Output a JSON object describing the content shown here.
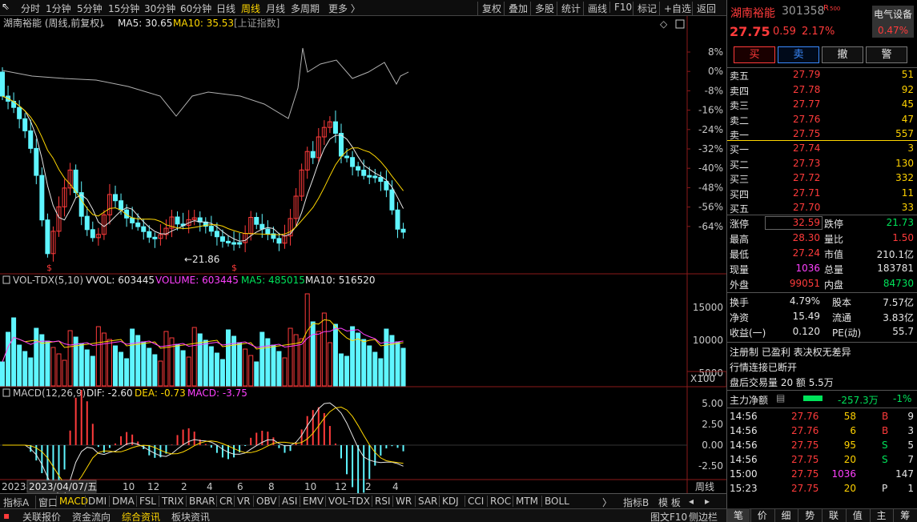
{
  "toolbar": {
    "periods": [
      "分时",
      "1分钟",
      "5分钟",
      "15分钟",
      "30分钟",
      "60分钟",
      "日线",
      "周线",
      "月线",
      "多周期",
      "更多 〉"
    ],
    "active_period": "周线",
    "tools": [
      "复权",
      "叠加",
      "多股",
      "统计",
      "画线",
      "F10",
      "标记",
      "+自选",
      "返回"
    ]
  },
  "main_chart": {
    "title": "湖南裕能 (周线,前复权)",
    "ma5_label": "MA5: 30.65",
    "ma10_label": "MA10: 35.53",
    "overlay_label": "[上证指数]",
    "y_ticks": [
      "8%",
      "0%",
      "-8%",
      "-16%",
      "-24%",
      "-32%",
      "-40%",
      "-48%",
      "-56%",
      "-64%"
    ],
    "low_marker": "21.86"
  },
  "volume_panel": {
    "name": "VOL-TDX(5,10)",
    "vvol": "VVOL: 603445",
    "volume": "VOLUME: 603445",
    "ma5": "MA5: 485015",
    "ma10": "MA10: 516520",
    "y_ticks": [
      "15000",
      "10000",
      "5000"
    ],
    "unit": "X100"
  },
  "macd_panel": {
    "name": "MACD(12,26,9)",
    "dif": "DIF: -2.60",
    "dea": "DEA: -0.73",
    "macd": "MACD: -3.75",
    "y_ticks": [
      "5.00",
      "2.50",
      "0.00",
      "-2.50"
    ]
  },
  "x_axis": {
    "start_label": "2023年",
    "cursor_label": "2023/04/07/五",
    "ticks": [
      "10",
      "12",
      "2",
      "4",
      "6",
      "8",
      "10",
      "12",
      "2",
      "4"
    ],
    "period_label": "周线"
  },
  "indicator_tabs": {
    "left_label": "指标A",
    "items": [
      "窗口",
      "MACD",
      "DMI",
      "DMA",
      "FSL",
      "TRIX",
      "BRAR",
      "CR",
      "VR",
      "OBV",
      "ASI",
      "EMV",
      "VOL-TDX",
      "RSI",
      "WR",
      "SAR",
      "KDJ",
      "CCI",
      "ROC",
      "MTM",
      "BOLL"
    ],
    "active": "MACD",
    "more_arrow": "〉",
    "right_label": "指标B",
    "template_label": "模 板"
  },
  "quote": {
    "name": "湖南裕能",
    "code": "301358",
    "badge": "R",
    "badge_sub": "500",
    "sector": "电气设备",
    "sector_change": "0.47%",
    "price": "27.75",
    "change": "0.59",
    "change_pct": "2.17%",
    "buttons": [
      "买",
      "卖",
      "撤",
      "警"
    ]
  },
  "order_book": {
    "asks": [
      {
        "label": "卖五",
        "price": "27.79",
        "vol": "51"
      },
      {
        "label": "卖四",
        "price": "27.78",
        "vol": "92"
      },
      {
        "label": "卖三",
        "price": "27.77",
        "vol": "45"
      },
      {
        "label": "卖二",
        "price": "27.76",
        "vol": "47"
      },
      {
        "label": "卖一",
        "price": "27.75",
        "vol": "557"
      }
    ],
    "bids": [
      {
        "label": "买一",
        "price": "27.74",
        "vol": "3"
      },
      {
        "label": "买二",
        "price": "27.73",
        "vol": "130"
      },
      {
        "label": "买三",
        "price": "27.72",
        "vol": "332"
      },
      {
        "label": "买四",
        "price": "27.71",
        "vol": "11"
      },
      {
        "label": "买五",
        "price": "27.70",
        "vol": "33"
      }
    ]
  },
  "stats": [
    {
      "l1": "涨停",
      "v1": "32.59",
      "l2": "跌停",
      "v2": "21.73"
    },
    {
      "l1": "最高",
      "v1": "28.30",
      "l2": "量比",
      "v2": "1.50"
    },
    {
      "l1": "最低",
      "v1": "27.24",
      "l2": "市值",
      "v2": "210.1亿"
    },
    {
      "l1": "现量",
      "v1": "1036",
      "l2": "总量",
      "v2": "183781"
    },
    {
      "l1": "外盘",
      "v1": "99051",
      "l2": "内盘",
      "v2": "84730"
    }
  ],
  "stats2": [
    {
      "l1": "换手",
      "v1": "4.79%",
      "l2": "股本",
      "v2": "7.57亿"
    },
    {
      "l1": "净资",
      "v1": "15.49",
      "l2": "流通",
      "v2": "3.83亿"
    },
    {
      "l1": "收益(一)",
      "v1": "0.120",
      "l2": "PE(动)",
      "v2": "55.7"
    }
  ],
  "info_lines": [
    "注册制 已盈利 表决权无差异",
    "行情连接已断开",
    "盘后交易量 20 额 5.5万"
  ],
  "main_flow": {
    "label": "主力净额",
    "value": "-257.3万",
    "pct": "-1%"
  },
  "trades": [
    {
      "time": "14:56",
      "price": "27.76",
      "vol": "58",
      "side": "B",
      "n": "9"
    },
    {
      "time": "14:56",
      "price": "27.76",
      "vol": "6",
      "side": "B",
      "n": "3"
    },
    {
      "time": "14:56",
      "price": "27.75",
      "vol": "95",
      "side": "S",
      "n": "5"
    },
    {
      "time": "14:56",
      "price": "27.75",
      "vol": "20",
      "side": "S",
      "n": "7"
    },
    {
      "time": "15:00",
      "price": "27.75",
      "vol": "1036",
      "side": "",
      "n": "147"
    },
    {
      "time": "15:23",
      "price": "27.75",
      "vol": "20",
      "side": "P",
      "n": "1"
    }
  ],
  "status_bar": [
    "关联报价",
    "资金流向",
    "综合资讯",
    "板块资讯"
  ],
  "status_right": [
    "图文F10",
    "侧边栏"
  ],
  "right_tabs": [
    "笔",
    "价",
    "细",
    "势",
    "联",
    "值",
    "主",
    "筹"
  ]
}
